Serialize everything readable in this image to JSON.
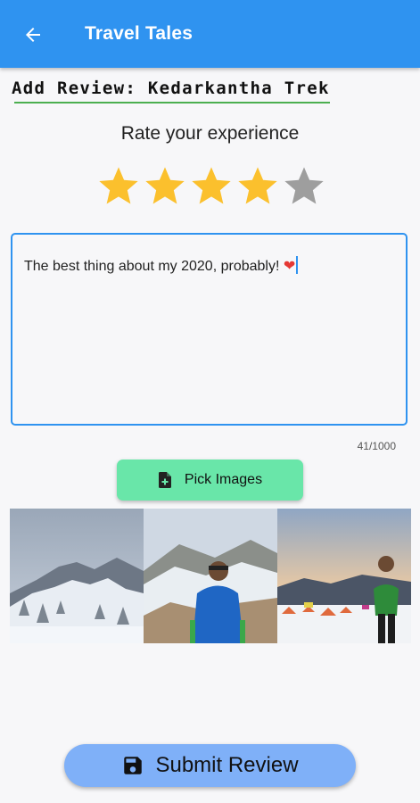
{
  "appbar": {
    "title": "Travel Tales",
    "back_icon": "arrow-left-icon"
  },
  "heading": "Add Review: Kedarkantha Trek",
  "rating": {
    "label": "Rate your experience",
    "value": 4,
    "max": 5,
    "filled_color": "#fbc02d",
    "empty_color": "#9e9e9e"
  },
  "review": {
    "text": "The best thing about my 2020, probably! ",
    "emoji": "❤",
    "char_count": "41/1000"
  },
  "pick_images": {
    "label": "Pick Images",
    "icon": "add-photo-icon"
  },
  "images": [
    {
      "name": "snowy-forest-mountain-photo"
    },
    {
      "name": "trekker-blue-poncho-photo"
    },
    {
      "name": "trekker-green-jacket-camp-photo"
    }
  ],
  "submit": {
    "label": "Submit Review",
    "icon": "save-icon"
  },
  "colors": {
    "primary": "#2f93f0",
    "accent_green": "#69e6a9",
    "submit_bg": "#7fb0f8",
    "underline": "#4caf50"
  }
}
